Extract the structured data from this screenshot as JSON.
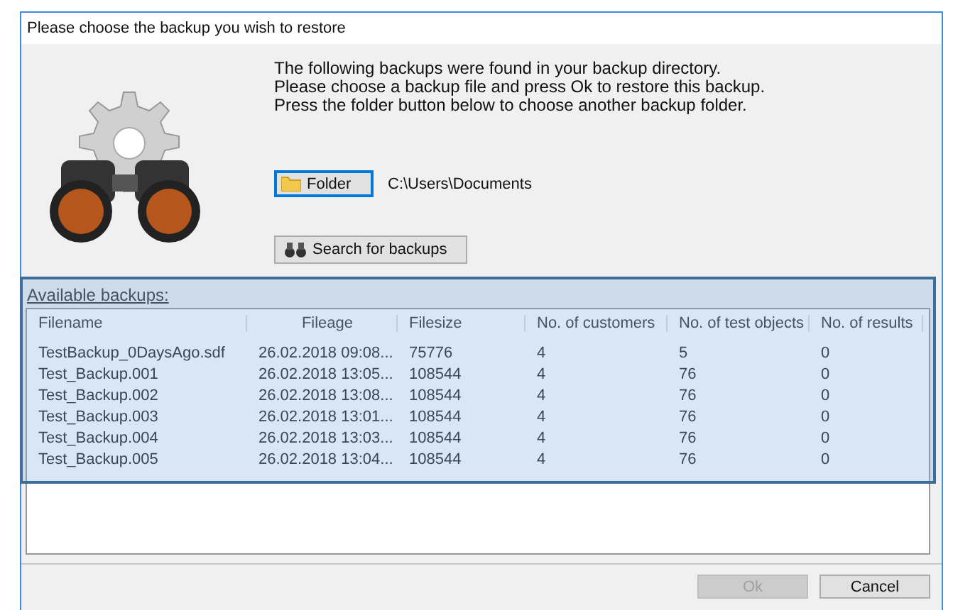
{
  "window": {
    "title": "Please choose the backup you wish to restore"
  },
  "intro_lines": [
    "The following backups were found in your backup directory.",
    "Please choose a backup file and press Ok to restore this backup.",
    "Press the folder button below to choose another backup folder."
  ],
  "folder_button": {
    "label": "Folder"
  },
  "folder_path": "C:\\Users\\Documents",
  "search_button": {
    "label": "Search for backups"
  },
  "backups_label": "Available backups:",
  "table": {
    "columns": [
      "Filename",
      "Fileage",
      "Filesize",
      "No. of customers",
      "No. of test objects",
      "No. of results"
    ],
    "rows": [
      [
        "TestBackup_0DaysAgo.sdf",
        "26.02.2018 09:08...",
        "75776",
        "4",
        "5",
        "0"
      ],
      [
        "Test_Backup.001",
        "26.02.2018 13:05...",
        "108544",
        "4",
        "76",
        "0"
      ],
      [
        "Test_Backup.002",
        "26.02.2018 13:08...",
        "108544",
        "4",
        "76",
        "0"
      ],
      [
        "Test_Backup.003",
        "26.02.2018 13:01...",
        "108544",
        "4",
        "76",
        "0"
      ],
      [
        "Test_Backup.004",
        "26.02.2018 13:03...",
        "108544",
        "4",
        "76",
        "0"
      ],
      [
        "Test_Backup.005",
        "26.02.2018 13:04...",
        "108544",
        "4",
        "76",
        "0"
      ]
    ]
  },
  "buttons": [
    {
      "label": "Ok",
      "disabled": true
    },
    {
      "label": "Cancel",
      "disabled": false
    }
  ]
}
